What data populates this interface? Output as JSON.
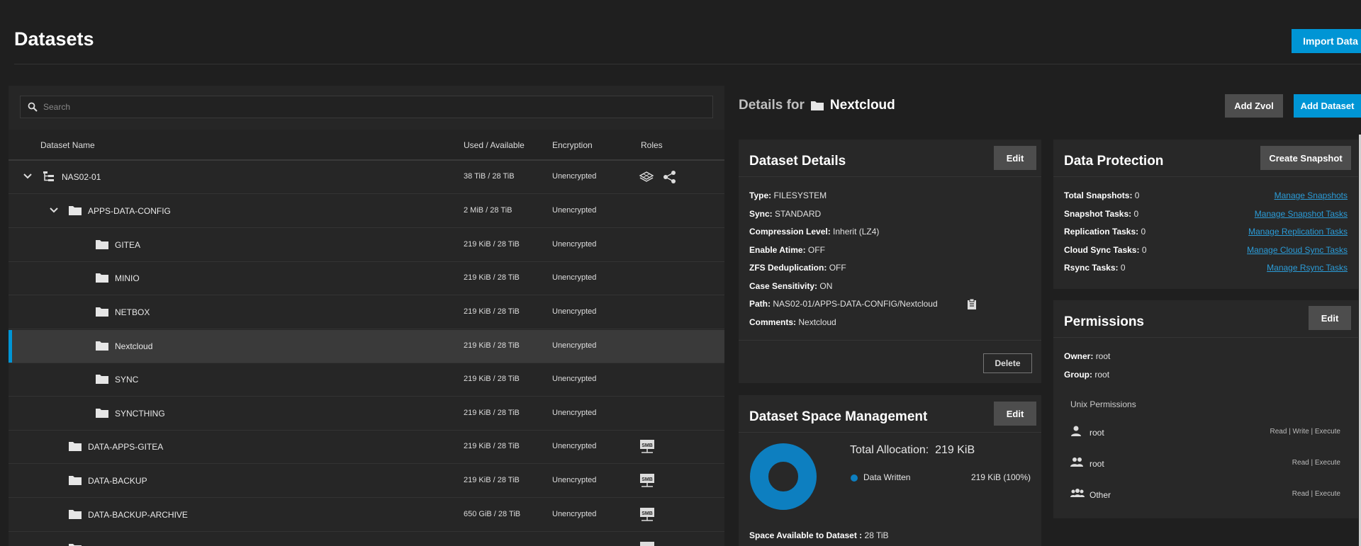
{
  "page": {
    "title": "Datasets",
    "import_label": "Import Data"
  },
  "search": {
    "placeholder": "Search"
  },
  "table": {
    "headers": {
      "name": "Dataset Name",
      "used": "Used / Available",
      "encryption": "Encryption",
      "roles": "Roles"
    },
    "rows": [
      {
        "name": "NAS02-01",
        "used": "38 TiB / 28 TiB",
        "encryption": "Unencrypted"
      },
      {
        "name": "APPS-DATA-CONFIG",
        "used": "2 MiB / 28 TiB",
        "encryption": "Unencrypted"
      },
      {
        "name": "GITEA",
        "used": "219 KiB / 28 TiB",
        "encryption": "Unencrypted"
      },
      {
        "name": "MINIO",
        "used": "219 KiB / 28 TiB",
        "encryption": "Unencrypted"
      },
      {
        "name": "NETBOX",
        "used": "219 KiB / 28 TiB",
        "encryption": "Unencrypted"
      },
      {
        "name": "Nextcloud",
        "used": "219 KiB / 28 TiB",
        "encryption": "Unencrypted"
      },
      {
        "name": "SYNC",
        "used": "219 KiB / 28 TiB",
        "encryption": "Unencrypted"
      },
      {
        "name": "SYNCTHING",
        "used": "219 KiB / 28 TiB",
        "encryption": "Unencrypted"
      },
      {
        "name": "DATA-APPS-GITEA",
        "used": "219 KiB / 28 TiB",
        "encryption": "Unencrypted"
      },
      {
        "name": "DATA-BACKUP",
        "used": "219 KiB / 28 TiB",
        "encryption": "Unencrypted"
      },
      {
        "name": "DATA-BACKUP-ARCHIVE",
        "used": "650 GiB / 28 TiB",
        "encryption": "Unencrypted"
      }
    ]
  },
  "details": {
    "prefix": "Details for",
    "name": "Nextcloud",
    "add_zvol": "Add Zvol",
    "add_dataset": "Add Dataset"
  },
  "dataset_details": {
    "title": "Dataset Details",
    "edit": "Edit",
    "delete": "Delete",
    "type_label": "Type:",
    "type": "FILESYSTEM",
    "sync_label": "Sync:",
    "sync": "STANDARD",
    "compression_label": "Compression Level:",
    "compression": "Inherit (LZ4)",
    "atime_label": "Enable Atime:",
    "atime": "OFF",
    "dedup_label": "ZFS Deduplication:",
    "dedup": "OFF",
    "case_label": "Case Sensitivity:",
    "case": "ON",
    "path_label": "Path:",
    "path": "NAS02-01/APPS-DATA-CONFIG/Nextcloud",
    "comments_label": "Comments:",
    "comments": "Nextcloud"
  },
  "space": {
    "title": "Dataset Space Management",
    "edit": "Edit",
    "total_label": "Total Allocation:",
    "total": "219 KiB",
    "legend_label": "Data Written",
    "legend_value": "219 KiB (100%)",
    "available_label": "Space Available to Dataset :",
    "available": "28 TiB",
    "donut_fraction": 1.0,
    "donut_color": "#0d7fc0"
  },
  "protection": {
    "title": "Data Protection",
    "create_snapshot": "Create Snapshot",
    "items": [
      {
        "label": "Total Snapshots:",
        "value": "0",
        "link": "Manage Snapshots"
      },
      {
        "label": "Snapshot Tasks:",
        "value": "0",
        "link": "Manage Snapshot Tasks"
      },
      {
        "label": "Replication Tasks:",
        "value": "0",
        "link": "Manage Replication Tasks"
      },
      {
        "label": "Cloud Sync Tasks:",
        "value": "0",
        "link": "Manage Cloud Sync Tasks"
      },
      {
        "label": "Rsync Tasks:",
        "value": "0",
        "link": "Manage Rsync Tasks"
      }
    ]
  },
  "permissions": {
    "title": "Permissions",
    "edit": "Edit",
    "owner_label": "Owner:",
    "owner": "root",
    "group_label": "Group:",
    "group": "root",
    "unix_label": "Unix Permissions",
    "rows": [
      {
        "name": "root",
        "perm": "Read | Write | Execute",
        "icon": "user-icon"
      },
      {
        "name": "root",
        "perm": "Read | Execute",
        "icon": "group-icon"
      },
      {
        "name": "Other",
        "perm": "Read | Execute",
        "icon": "others-icon"
      }
    ]
  }
}
